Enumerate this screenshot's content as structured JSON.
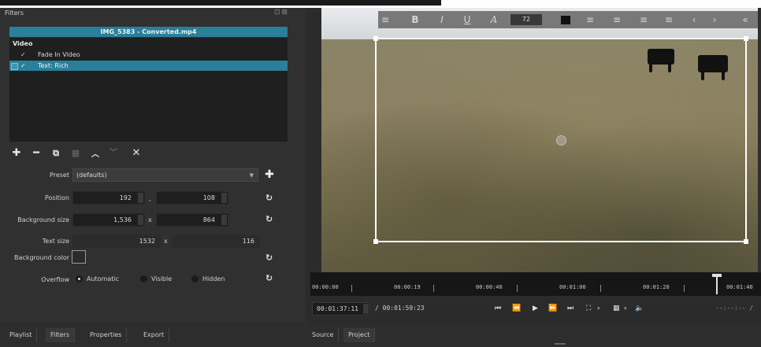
{
  "filters_panel": {
    "title": "Filters",
    "window_controls": "⊡⊠",
    "clip_title": "IMG_5383 - Converted.mp4",
    "category": "Video",
    "filters": [
      {
        "checked": "✓",
        "name": "Fade In Video",
        "selected": false
      },
      {
        "checked": "✓",
        "name": "Text: Rich",
        "selected": true
      }
    ],
    "toolbar": {
      "add": "✚",
      "remove": "━",
      "copy": "⧉",
      "paste": "▦",
      "move_up": "︿",
      "move_down": "﹀",
      "deselect": "✕"
    }
  },
  "properties": {
    "preset_label": "Preset",
    "preset_value": "(defaults)",
    "preset_add": "✚",
    "position_label": "Position",
    "position_x": "192",
    "position_sep": ",",
    "position_y": "108",
    "bg_size_label": "Background size",
    "bg_size_w": "1,536",
    "bg_size_sep": "x",
    "bg_size_h": "864",
    "text_size_label": "Text size",
    "text_size_w": "1532",
    "text_size_sep": "x",
    "text_size_h": "116",
    "bg_color_label": "Background color",
    "overflow_label": "Overflow",
    "overflow_options": [
      "Automatic",
      "Visible",
      "Hidden"
    ],
    "overflow_selected": "Automatic",
    "reset_icon": "↻"
  },
  "left_tabs": [
    "Playlist",
    "Filters",
    "Properties",
    "Export"
  ],
  "text_toolbar": {
    "menu": "≡",
    "bold": "B",
    "italic": "I",
    "underline": "U",
    "font": "A",
    "font_size": "72",
    "text_color": "#111111",
    "align_left": "≡",
    "align_center": "≡",
    "align_right": "≡",
    "align_justify": "≡",
    "back": "‹",
    "forward": "›",
    "collapse": "«"
  },
  "timeline": {
    "ticks": [
      "00:00:00",
      "00:00:19",
      "00:00:40",
      "00:01:00",
      "00:01:20",
      "00:01:40"
    ]
  },
  "transport": {
    "current_time": "00:01:37:11",
    "total_time": "/ 00:01:59:23",
    "in_out": "--:--:-- /",
    "controls": {
      "skip_start": "⏮",
      "rewind": "⏪",
      "play": "▶",
      "fast_forward": "⏩",
      "skip_end": "⏭",
      "zoom": "⛶",
      "grid": "▦",
      "volume": "🔈"
    }
  },
  "right_tabs": [
    "Source",
    "Project"
  ],
  "colors": {
    "accent": "#2a7f9a",
    "panel_bg": "#303030",
    "list_bg": "#1f1f1f"
  }
}
